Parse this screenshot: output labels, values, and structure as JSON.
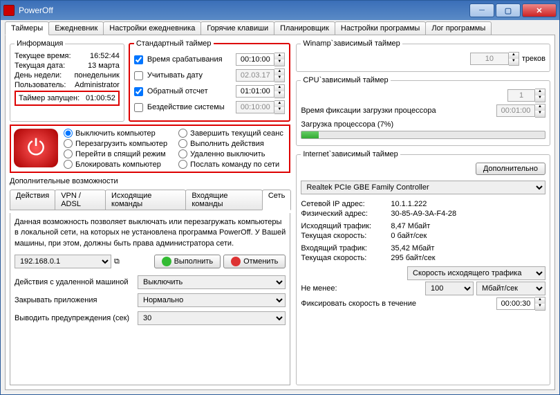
{
  "window": {
    "title": "PowerOff"
  },
  "tabs": [
    "Таймеры",
    "Ежедневник",
    "Настройки ежедневника",
    "Горячие клавиши",
    "Планировщик",
    "Настройки программы",
    "Лог программы"
  ],
  "activeTab": 0,
  "info": {
    "legend": "Информация",
    "rows": [
      {
        "k": "Текущее время:",
        "v": "16:52:44"
      },
      {
        "k": "Текущая дата:",
        "v": "13 марта"
      },
      {
        "k": "День недели:",
        "v": "понедельник"
      },
      {
        "k": "Пользователь:",
        "v": "Administrator"
      }
    ],
    "timerStarted": {
      "k": "Таймер запущен:",
      "v": "01:00:52"
    }
  },
  "stdTimer": {
    "legend": "Стандартный таймер",
    "rows": [
      {
        "checked": true,
        "label": "Время срабатывания",
        "value": "00:10:00",
        "enabled": true
      },
      {
        "checked": false,
        "label": "Учитывать дату",
        "value": "02.03.17",
        "enabled": false
      },
      {
        "checked": true,
        "label": "Обратный отсчет",
        "value": "01:01:00",
        "enabled": true
      },
      {
        "checked": false,
        "label": "Бездействие системы",
        "value": "00:10:00",
        "enabled": false
      }
    ]
  },
  "actions": {
    "col1": [
      "Выключить компьютер",
      "Перезагрузить компьютер",
      "Перейти в спящий режим",
      "Блокировать компьютер"
    ],
    "col2": [
      "Завершить текущий сеанс",
      "Выполнить действия",
      "Удаленно выключить",
      "Послать команду по сети"
    ],
    "selected": 0
  },
  "extra": "Дополнительные возможности",
  "subtabs": [
    "Действия",
    "VPN / ADSL",
    "Исходящие команды",
    "Входящие команды",
    "Сеть"
  ],
  "activeSubtab": 4,
  "net": {
    "desc": "Данная возможность позволяет выключать или перезагружать компьютеры в локальной сети, на которых не установлена программа PowerOff. У Вашей машины, при этом, должны быть права администратора сети.",
    "ip": "192.168.0.1",
    "execute": "Выполнить",
    "cancel": "Отменить",
    "rows": [
      {
        "lbl": "Действия с удаленной машиной",
        "val": "Выключить"
      },
      {
        "lbl": "Закрывать приложения",
        "val": "Нормально"
      },
      {
        "lbl": "Выводить предупреждения (сек)",
        "val": "30"
      }
    ]
  },
  "winamp": {
    "legend": "Winamp`зависимый таймер",
    "value": "10",
    "suffix": "треков"
  },
  "cpu": {
    "legend": "CPU`зависимый таймер",
    "threshold": "1",
    "fixLabel": "Время фиксации загрузки процессора",
    "fixValue": "00:01:00",
    "loadLabel": "Загрузка процессора (7%)",
    "loadPct": 7
  },
  "internet": {
    "legend": "Internet`зависимый таймер",
    "moreBtn": "Дополнительно",
    "adapter": "Realtek PCIe GBE Family Controller",
    "kv": [
      {
        "k": "Сетевой IP адрес:",
        "v": "10.1.1.222"
      },
      {
        "k": "Физический адрес:",
        "v": "30-85-A9-3A-F4-28"
      },
      {
        "k": "Исходящий трафик:",
        "v": "8,47 Мбайт"
      },
      {
        "k": "Текущая скорость:",
        "v": "0 байт/сек"
      },
      {
        "k": "Входящий трафик:",
        "v": "35,42 Мбайт"
      },
      {
        "k": "Текущая скорость:",
        "v": "295 байт/сек"
      }
    ],
    "speedType": "Скорость исходящего трафика",
    "minLabel": "Не менее:",
    "minVal": "100",
    "unit": "Мбайт/сек",
    "fixLabel": "Фиксировать скорость в течение",
    "fixVal": "00:00:30"
  }
}
